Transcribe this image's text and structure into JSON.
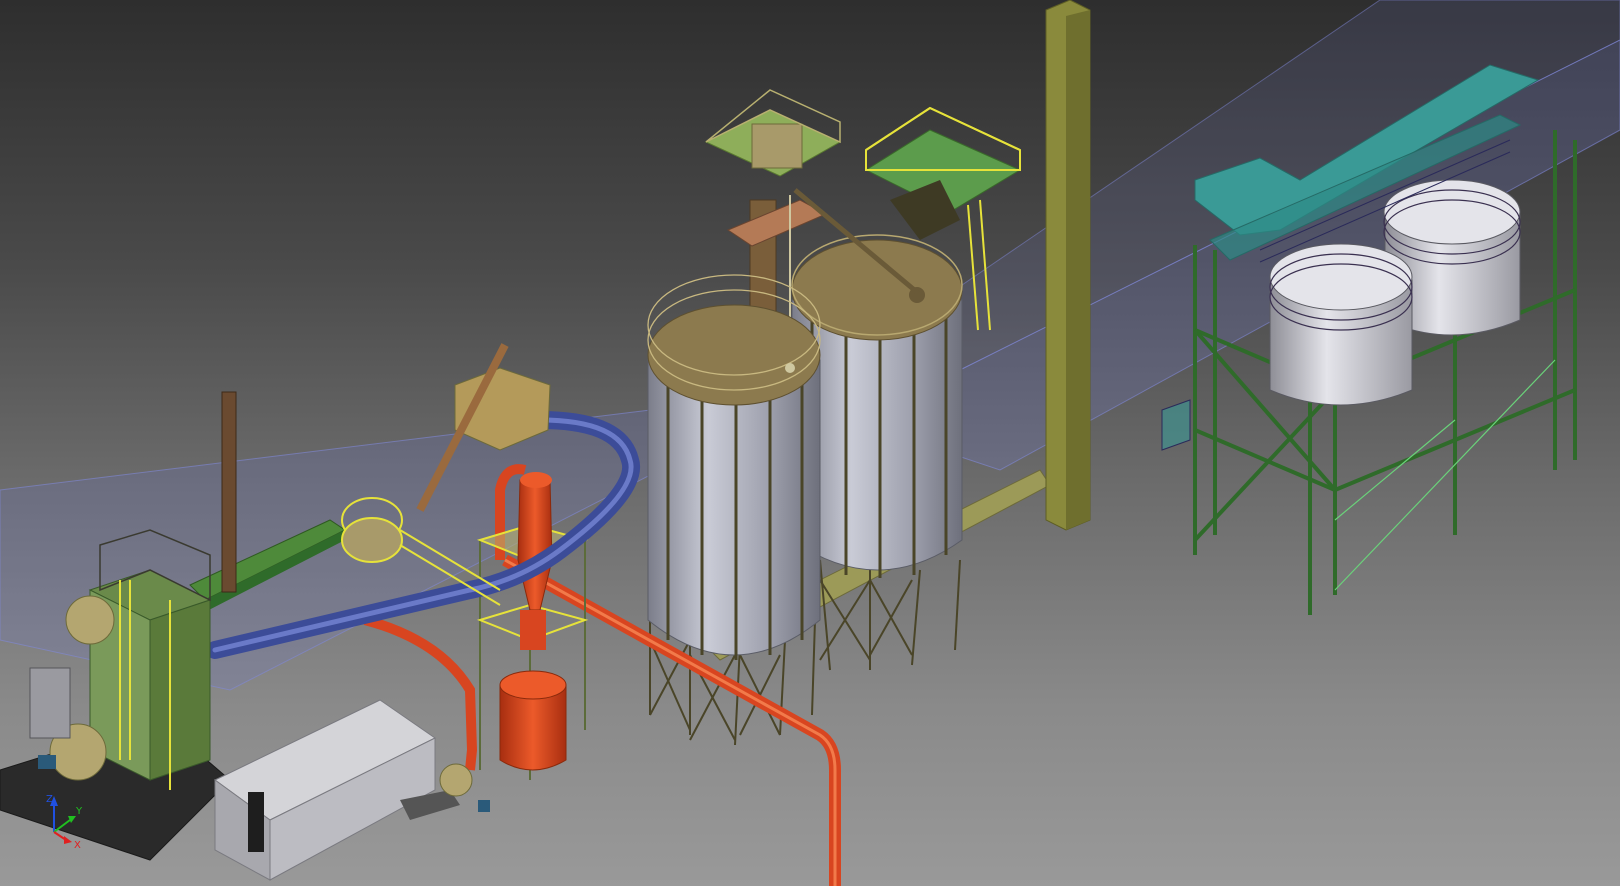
{
  "viewport": {
    "background_top": "#2e2e2e",
    "background_bottom": "#999999"
  },
  "triad": {
    "x_label": "X",
    "y_label": "Y",
    "z_label": "Z",
    "x_color": "#e02020",
    "y_color": "#20c020",
    "z_color": "#2050e0"
  },
  "colors": {
    "silo_body": "#a9abb8",
    "silo_roof": "#8c7a4e",
    "structure_olive": "#6d6a3a",
    "railing_yellow": "#e6e23a",
    "pipe_red": "#d84520",
    "duct_blue": "#3c4c98",
    "frame_green": "#2f6b2a",
    "roof_teal": "#3a9a96",
    "ghost_blue": "#6f78c8",
    "tank_white": "#d8d8dc",
    "stack_olive": "#8a8a3c",
    "building_gray": "#b5b5bb"
  }
}
